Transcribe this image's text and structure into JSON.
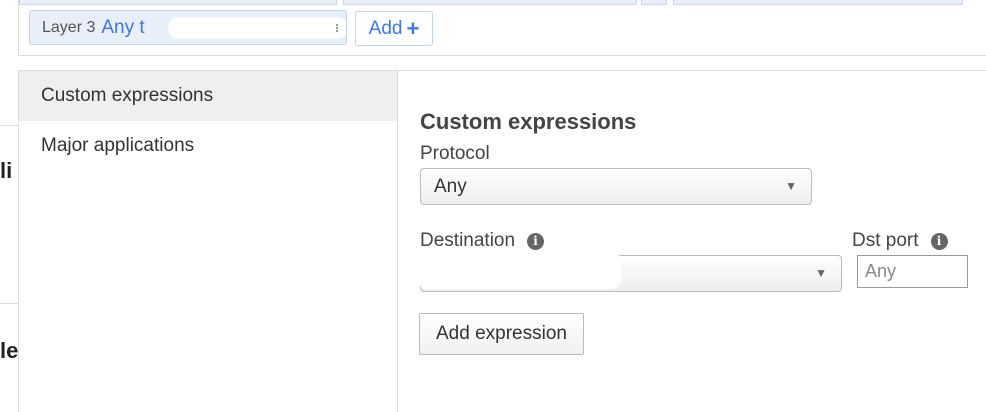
{
  "filter_bar": {
    "chip_layer": "Layer 3",
    "chip_value": "Any t",
    "add_label": "Add"
  },
  "page_fragments": {
    "frag1": "li",
    "frag2": "le"
  },
  "sidebar": {
    "items": [
      {
        "label": "Custom expressions",
        "active": true
      },
      {
        "label": "Major applications",
        "active": false
      }
    ]
  },
  "form": {
    "section_title": "Custom expressions",
    "protocol_label": "Protocol",
    "protocol_value": "Any",
    "destination_label": "Destination",
    "dst_port_label": "Dst port",
    "dst_port_placeholder": "Any",
    "add_expression_label": "Add expression"
  },
  "icons": {
    "info": "info-icon",
    "plus": "plus-icon",
    "caret": "chevron-down-icon"
  },
  "colors": {
    "accent": "#3b78e7",
    "chip_bg": "#e8effa",
    "active_item_bg": "#efefef"
  }
}
